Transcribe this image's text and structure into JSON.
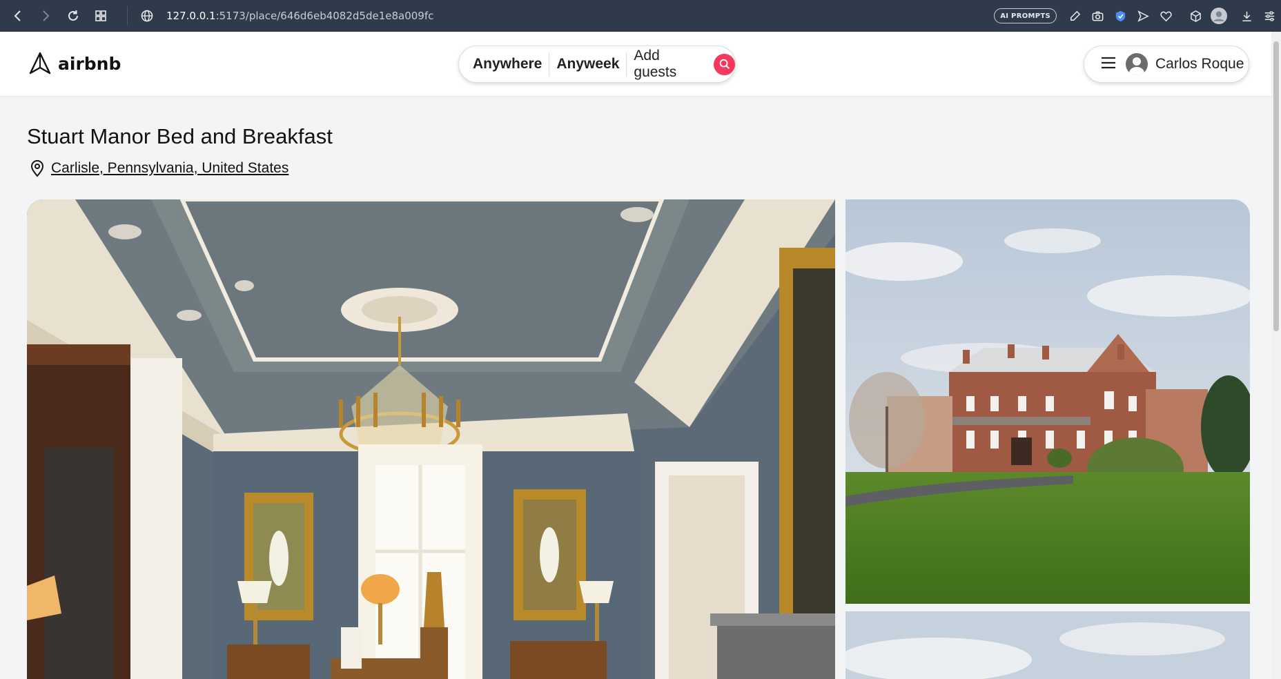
{
  "browser": {
    "url_host": "127.0.0.1",
    "url_rest": ":5173/place/646d6eb4082d5de1e8a009fc",
    "ai_prompts_label": "AI PROMPTS"
  },
  "header": {
    "logo_text": "airbnb",
    "search": {
      "where": "Anywhere",
      "when": "Anyweek",
      "guests": "Add guests"
    },
    "user_name": "Carlos Roque"
  },
  "listing": {
    "title": "Stuart Manor Bed and Breakfast",
    "address": "Carlisle, Pennsylvania, United States"
  },
  "colors": {
    "brand": "#f5385d",
    "browser_bar": "#2f3b4a",
    "page_bg": "#f3f4f6"
  },
  "icons": [
    "back-icon",
    "forward-icon",
    "reload-icon",
    "tabs-grid-icon",
    "globe-icon",
    "edit-icon",
    "camera-icon",
    "shield-icon",
    "send-icon",
    "heart-icon",
    "box-icon",
    "profile-icon",
    "download-icon",
    "sliders-icon",
    "logo-icon",
    "search-icon",
    "hamburger-icon",
    "map-pin-icon"
  ]
}
